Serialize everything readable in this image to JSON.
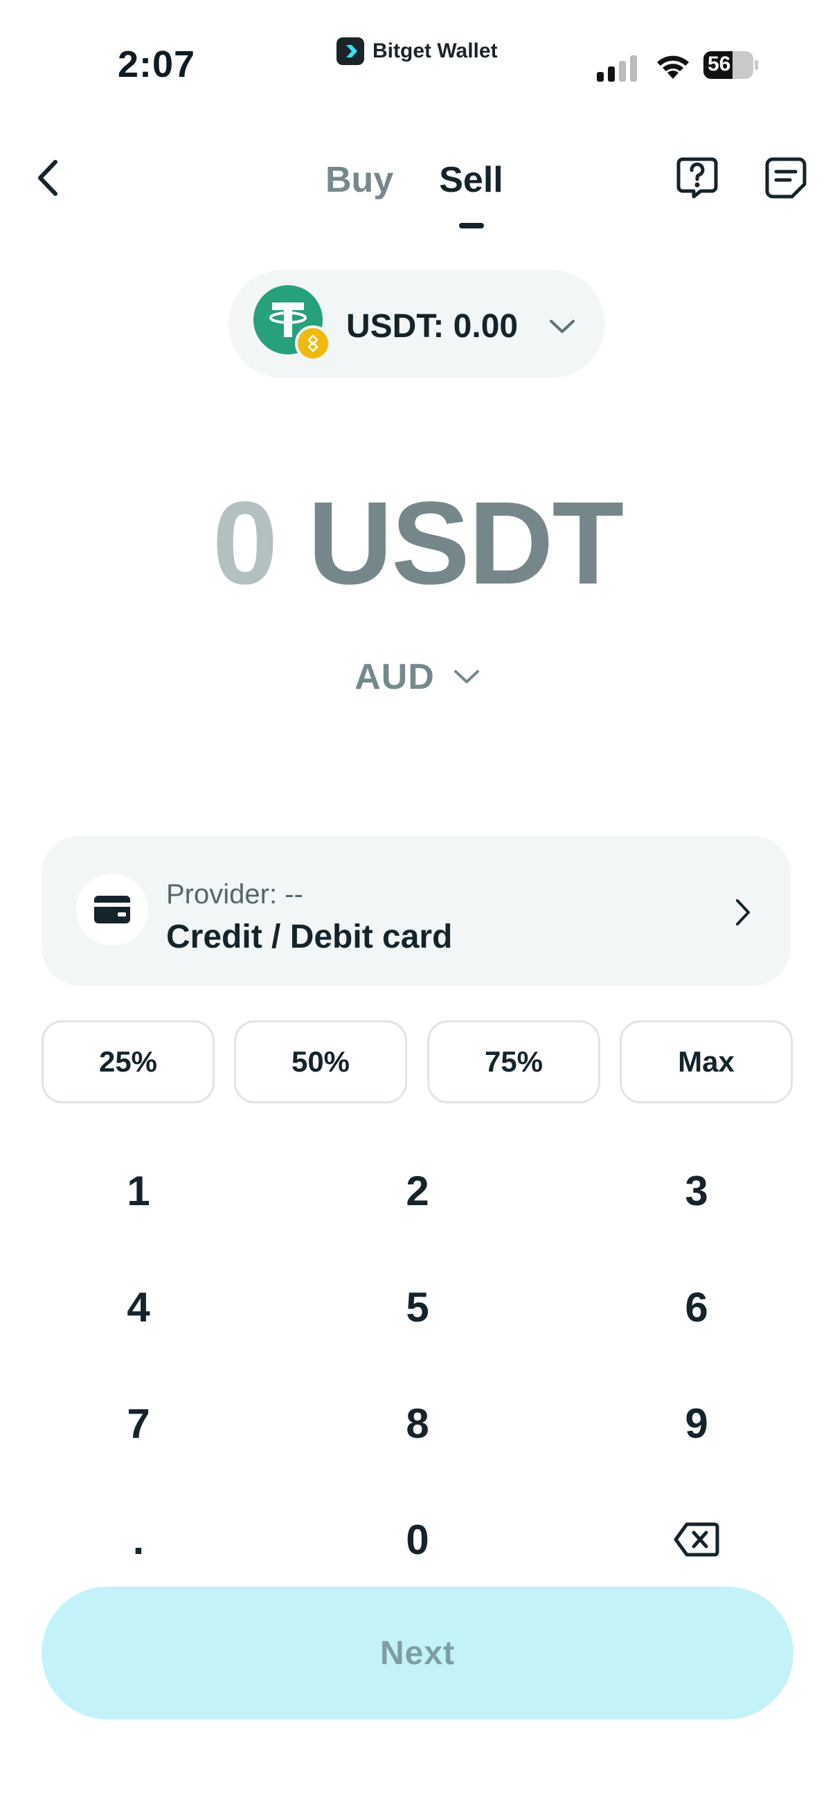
{
  "status_bar": {
    "time": "2:07",
    "app_name": "Bitget Wallet",
    "battery": "56",
    "icons": [
      "signal-icon",
      "wifi-icon",
      "battery-icon"
    ]
  },
  "header": {
    "tabs": [
      {
        "label": "Buy",
        "active": false
      },
      {
        "label": "Sell",
        "active": true
      }
    ],
    "icons": [
      "back-arrow-icon",
      "help-icon",
      "orders-icon"
    ]
  },
  "token": {
    "label": "USDT: 0.00",
    "logo_color": "#27a17c",
    "badge_color": "#f0b90b"
  },
  "amount": {
    "value": "0",
    "currency": "USDT"
  },
  "fiat": {
    "label": "AUD"
  },
  "provider": {
    "small_label": "Provider: --",
    "method": "Credit / Debit card"
  },
  "percent_options": [
    "25%",
    "50%",
    "75%",
    "Max"
  ],
  "keypad": {
    "keys": [
      "1",
      "2",
      "3",
      "4",
      "5",
      "6",
      "7",
      "8",
      "9",
      ".",
      "0"
    ]
  },
  "next_button": {
    "label": "Next",
    "bg": "#c3f3f8"
  }
}
